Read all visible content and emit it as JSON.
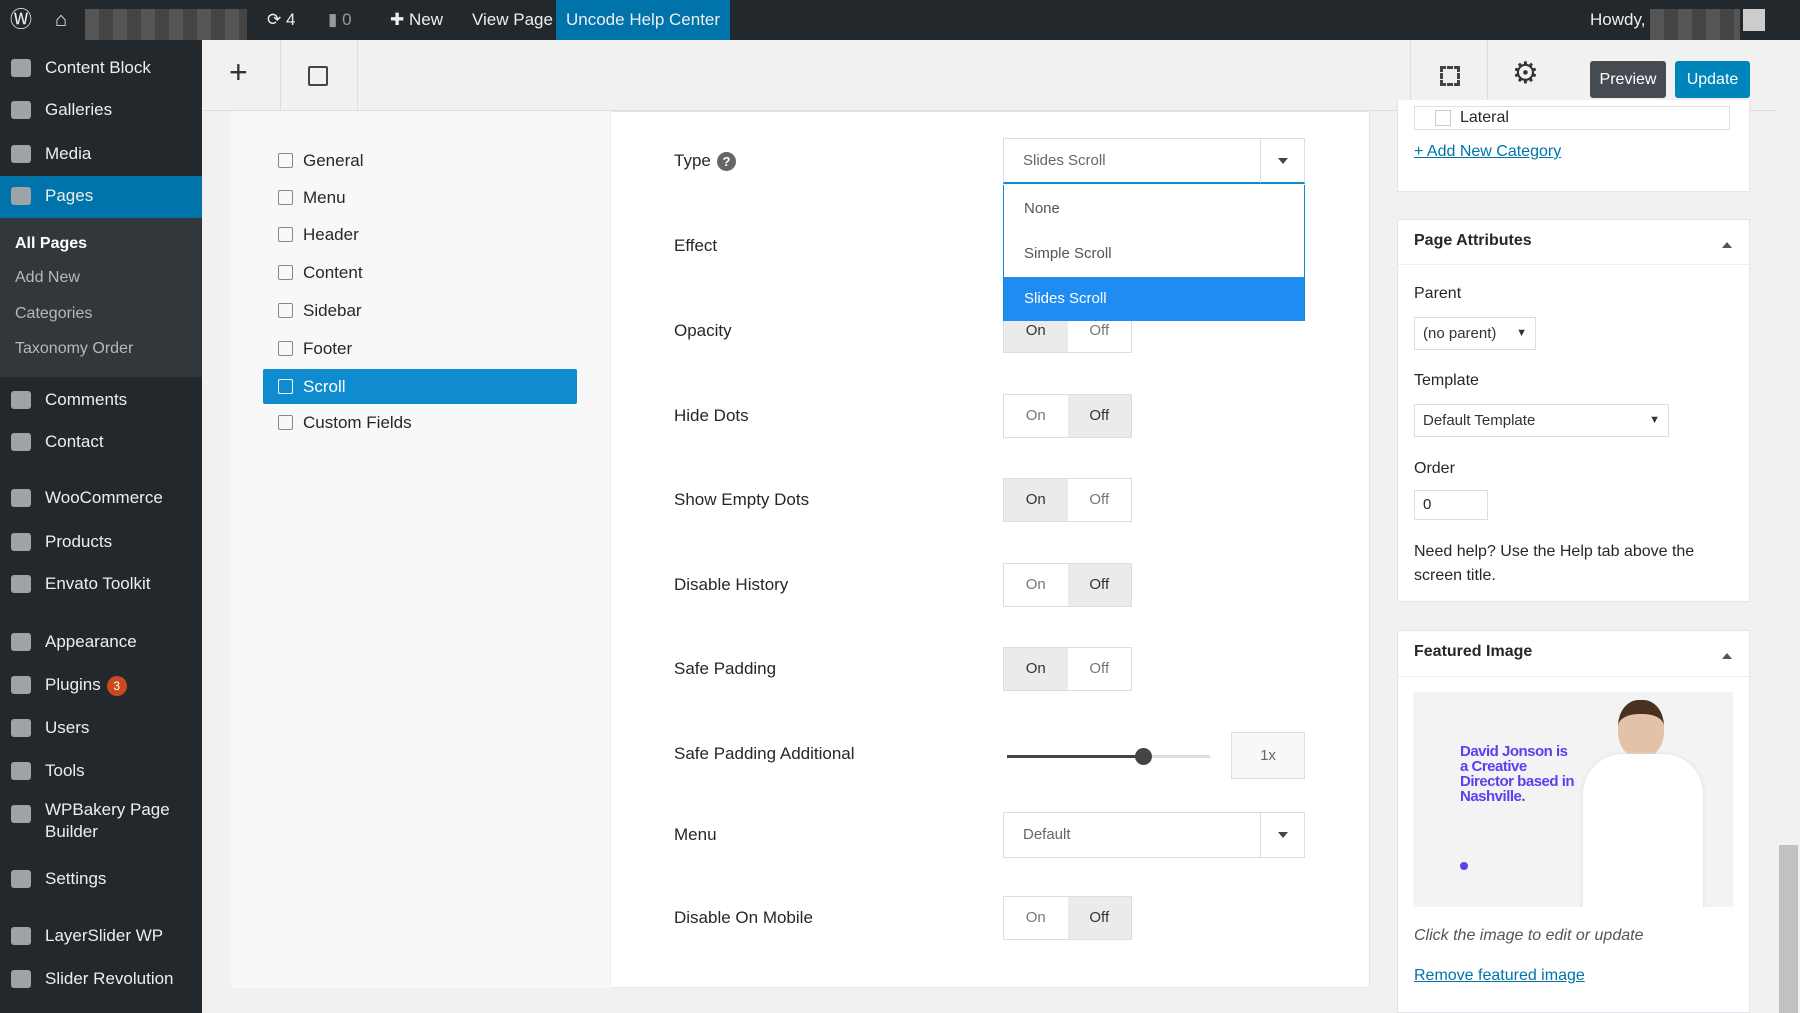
{
  "topbar": {
    "updates": "4",
    "comments": "0",
    "new": "New",
    "view_page": "View Page",
    "help_center": "Uncode Help Center",
    "howdy": "Howdy,"
  },
  "sidebar": {
    "items": [
      "Content Block",
      "Galleries",
      "Media",
      "Pages",
      "Comments",
      "Contact",
      "WooCommerce",
      "Products",
      "Envato Toolkit",
      "Appearance",
      "Plugins",
      "Users",
      "Tools",
      "WPBakery Page Builder",
      "Settings",
      "LayerSlider WP",
      "Slider Revolution"
    ],
    "submenu": [
      "All Pages",
      "Add New",
      "Categories",
      "Taxonomy Order"
    ],
    "plugins_badge": "3"
  },
  "toolbar": {
    "preview": "Preview",
    "update": "Update"
  },
  "nav": [
    "General",
    "Menu",
    "Header",
    "Content",
    "Sidebar",
    "Footer",
    "Scroll",
    "Custom Fields"
  ],
  "fields": {
    "type": "Type",
    "type_value": "Slides Scroll",
    "type_options": [
      "None",
      "Simple Scroll",
      "Slides Scroll"
    ],
    "effect": "Effect",
    "opacity": "Opacity",
    "hide_dots": "Hide Dots",
    "show_empty_dots": "Show Empty Dots",
    "disable_history": "Disable History",
    "safe_padding": "Safe Padding",
    "safe_padding_additional": "Safe Padding Additional",
    "safe_padding_value": "1x",
    "menu": "Menu",
    "menu_value": "Default",
    "disable_on_mobile": "Disable On Mobile",
    "on": "On",
    "off": "Off",
    "help": "?"
  },
  "right": {
    "category": "Lateral",
    "add_category": "+ Add New Category",
    "page_attributes": "Page Attributes",
    "parent": "Parent",
    "parent_value": "(no parent)",
    "template": "Template",
    "template_value": "Default Template",
    "order": "Order",
    "order_value": "0",
    "help": "Need help? Use the Help tab above the screen title.",
    "featured_image": "Featured Image",
    "image_headline": "David Jonson is a Creative Director based in Nashville.",
    "caption": "Click the image to edit or update",
    "remove": "Remove featured image"
  },
  "colors": {
    "accent": "#0f8bd0",
    "admin_bar": "#23282d",
    "update": "#0085ba",
    "badge": "#ca4a1f"
  }
}
